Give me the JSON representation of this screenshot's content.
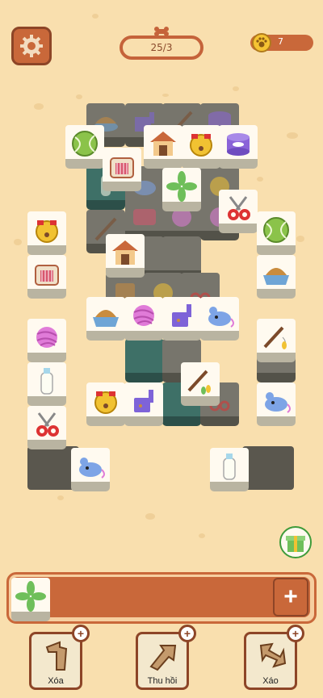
{
  "header": {
    "level": "25/3",
    "coins": "7"
  },
  "powerups": [
    {
      "label": "Xóa",
      "icon": "undo-arrow-icon"
    },
    {
      "label": "Thu hồi",
      "icon": "return-arrow-icon"
    },
    {
      "label": "Xáo",
      "icon": "shuffle-arrow-icon"
    }
  ],
  "tray": {
    "tiles": [
      "leaf"
    ],
    "add_symbol": "+"
  },
  "colors": {
    "background": "#f9dfae",
    "accent": "#c9683a",
    "tile_face": "#fffaf0"
  },
  "board": {
    "open_tiles": [
      "tennis-ball",
      "pet-house",
      "bell",
      "cat-food-can",
      "pet-carrier",
      "leaf",
      "nail-clipper",
      "bell",
      "tennis-ball",
      "pet-carrier",
      "pet-house",
      "food-bowl",
      "yarn-ball",
      "food-bowl",
      "yarn-ball",
      "dust-pan",
      "toy-mouse",
      "yarn-ball",
      "cat-wand",
      "milk-bottle",
      "bell",
      "dust-pan",
      "cat-wand",
      "toy-mouse",
      "nail-clipper",
      "toy-mouse",
      "milk-bottle"
    ]
  }
}
